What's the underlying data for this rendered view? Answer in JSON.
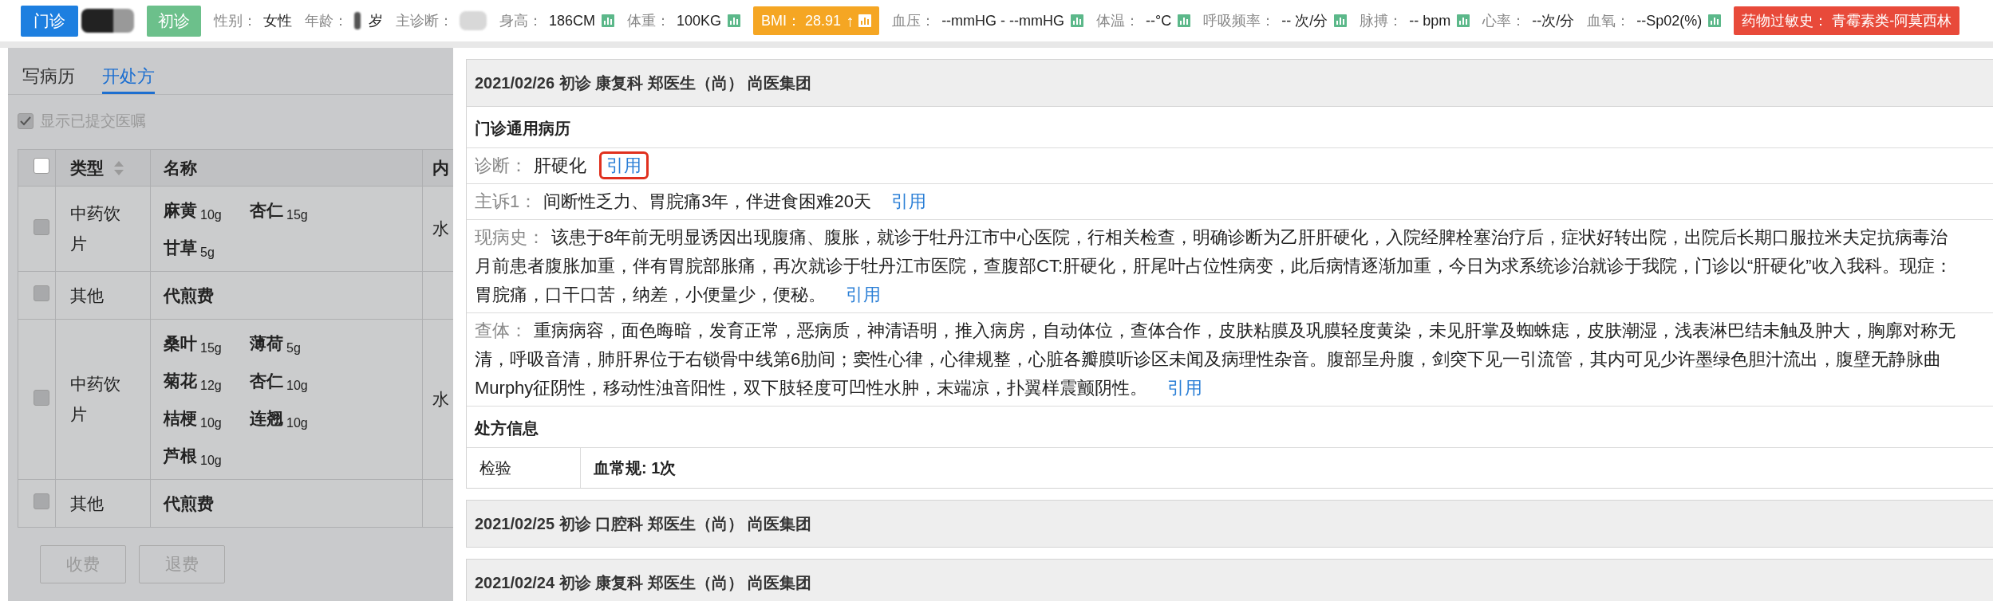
{
  "header": {
    "visit_type": "门诊",
    "patient_name": {
      "redacted": true
    },
    "visit_tag": "初诊",
    "fields": [
      {
        "kind": "plain",
        "label": "性别：",
        "value": "女性"
      },
      {
        "kind": "plain",
        "label": "年龄：",
        "value": "岁",
        "redacted": true
      },
      {
        "kind": "plain",
        "label": "主诊断：",
        "redacted": true
      },
      {
        "kind": "plain",
        "label": "身高：",
        "value": "186CM",
        "chart": true
      },
      {
        "kind": "plain",
        "label": "体重：",
        "value": "100KG",
        "chart": true
      },
      {
        "kind": "warning",
        "label": "BMI：",
        "value": "28.91",
        "arrow": "↑",
        "chart": true
      },
      {
        "kind": "plain",
        "label": "血压：",
        "value": "--mmHG - --mmHG",
        "chart": true
      },
      {
        "kind": "plain",
        "label": "体温：",
        "value": "--°C",
        "chart": true
      },
      {
        "kind": "plain",
        "label": "呼吸频率：",
        "value": "-- 次/分",
        "chart": true
      },
      {
        "kind": "plain",
        "label": "脉搏：",
        "value": "-- bpm",
        "chart": true
      },
      {
        "kind": "plain",
        "label": "心率：",
        "value": "--次/分"
      },
      {
        "kind": "plain",
        "label": "血氧：",
        "value": "--Sp02(%)",
        "chart": true
      },
      {
        "kind": "danger",
        "label": "药物过敏史：",
        "value": "青霉素类-阿莫西林"
      }
    ]
  },
  "prescription_panel": {
    "tabs": [
      {
        "label": "写病历",
        "selected": false
      },
      {
        "label": "开处方",
        "selected": true
      }
    ],
    "show_submitted": {
      "label": "显示已提交医嘱",
      "checked": true
    },
    "table": {
      "columns": [
        "类型",
        "名称",
        "内"
      ],
      "header_checked": false,
      "rows": [
        {
          "checked": false,
          "disabled": true,
          "type": "中药饮片",
          "items": [
            {
              "name": "麻黄",
              "dose": "10g"
            },
            {
              "name": "杏仁",
              "dose": "15g"
            },
            {
              "name": "甘草",
              "dose": "5g"
            }
          ],
          "column_4": "水"
        },
        {
          "checked": false,
          "disabled": true,
          "type": "其他",
          "items": [
            {
              "name": "代煎费"
            }
          ]
        },
        {
          "checked": false,
          "disabled": true,
          "type": "中药饮片",
          "items": [
            {
              "name": "桑叶",
              "dose": "15g"
            },
            {
              "name": "薄荷",
              "dose": "5g"
            },
            {
              "name": "菊花",
              "dose": "12g"
            },
            {
              "name": "杏仁",
              "dose": "10g"
            },
            {
              "name": "桔梗",
              "dose": "10g"
            },
            {
              "name": "连翘",
              "dose": "10g"
            },
            {
              "name": "芦根",
              "dose": "10g"
            }
          ],
          "column_4": "水"
        },
        {
          "checked": false,
          "disabled": true,
          "type": "其他",
          "items": [
            {
              "name": "代煎费"
            }
          ]
        }
      ]
    },
    "buttons": [
      {
        "label": "收费",
        "disabled": true
      },
      {
        "label": "退费",
        "disabled": true
      }
    ]
  },
  "records": [
    {
      "title": "2021/02/26 初诊 康复科 郑医生（尚） 尚医集团",
      "expanded": true,
      "form_title": "门诊通用病历",
      "fields": [
        {
          "label": "诊断：",
          "lines": [
            "肝硬化"
          ],
          "action": "引用",
          "highlighted": true
        },
        {
          "label": "主诉1：",
          "lines": [
            "间断性乏力、胃脘痛3年，伴进食困难20天"
          ],
          "action": "引用",
          "highlighted": false
        },
        {
          "label": "现病史：",
          "lines": [
            "该患于8年前无明显诱因出现腹痛、腹胀，就诊于牡丹江市中心医院，行相关检查，明确诊断为乙肝肝硬化，入院经脾栓塞治疗后，症状好转出院，出院后长期口服拉米夫定抗病毒治",
            "月前患者腹胀加重，伴有胃脘部胀痛，再次就诊于牡丹江市医院，查腹部CT:肝硬化，肝尾叶占位性病变，此后病情逐渐加重，今日为求系统诊治就诊于我院，门诊以“肝硬化”收入我科。现症：",
            "胃脘痛，口干口苦，纳差，小便量少，便秘。"
          ],
          "action": "引用",
          "highlighted": false
        },
        {
          "label": "查体：",
          "lines": [
            "重病病容，面色晦暗，发育正常，恶病质，神清语明，推入病房，自动体位，查体合作，皮肤粘膜及巩膜轻度黄染，未见肝掌及蜘蛛痣，皮肤潮湿，浅表淋巴结未触及肿大，胸廓对称无",
            "清，呼吸音清，肺肝界位于右锁骨中线第6肋间；窦性心律，心律规整，心脏各瓣膜听诊区未闻及病理性杂音。腹部呈舟腹，剑突下见一引流管，其内可见少许墨绿色胆汁流出，腹壁无静脉曲",
            "Murphy征阴性，移动性浊音阳性，双下肢轻度可凹性水肿，末端凉，扑翼样震颤阴性。"
          ],
          "action": "引用",
          "highlighted": false
        }
      ],
      "prescription": {
        "title": "处方信息",
        "rows": [
          {
            "label": "检验",
            "value": "血常规: 1次"
          }
        ]
      }
    },
    {
      "title": "2021/02/25 初诊 口腔科 郑医生（尚） 尚医集团",
      "expanded": false
    },
    {
      "title": "2021/02/24 初诊 康复科 郑医生（尚） 尚医集团",
      "expanded": false
    }
  ]
}
